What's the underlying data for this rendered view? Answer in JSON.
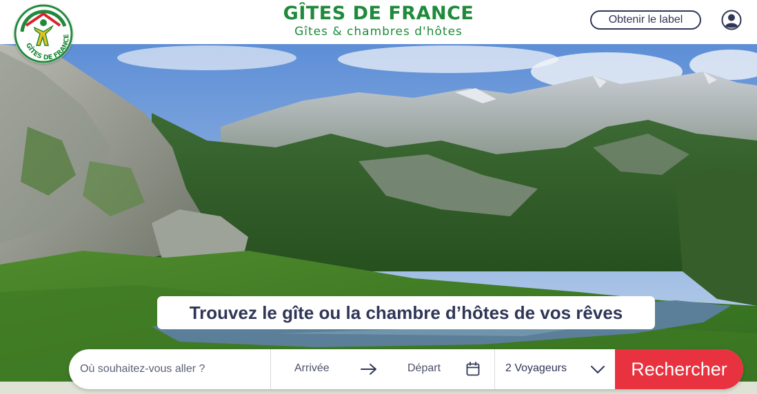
{
  "brand": {
    "title": "GÎTES DE FRANCE",
    "subtitle": "Gîtes & chambres d'hôtes",
    "logo_text": "GÎTES DE FRANCE",
    "color": "#1f8a3b",
    "logo_accent": "#d8232a",
    "logo_figure": "#e9c31c"
  },
  "header": {
    "label_button": "Obtenir le label",
    "account_icon": "user-circle-icon"
  },
  "hero": {
    "tagline": "Trouvez le gîte ou la chambre d’hôtes de vos rêves"
  },
  "search": {
    "where_placeholder": "Où souhaitez-vous aller ?",
    "arrival_label": "Arrivée",
    "departure_label": "Départ",
    "guests_value": "2 Voyageurs",
    "submit_label": "Rechercher",
    "submit_color": "#e8323f",
    "icons": [
      "arrow-right-icon",
      "calendar-icon",
      "chevron-down-icon"
    ]
  },
  "colors": {
    "navy": "#2f3656",
    "white": "#ffffff"
  }
}
